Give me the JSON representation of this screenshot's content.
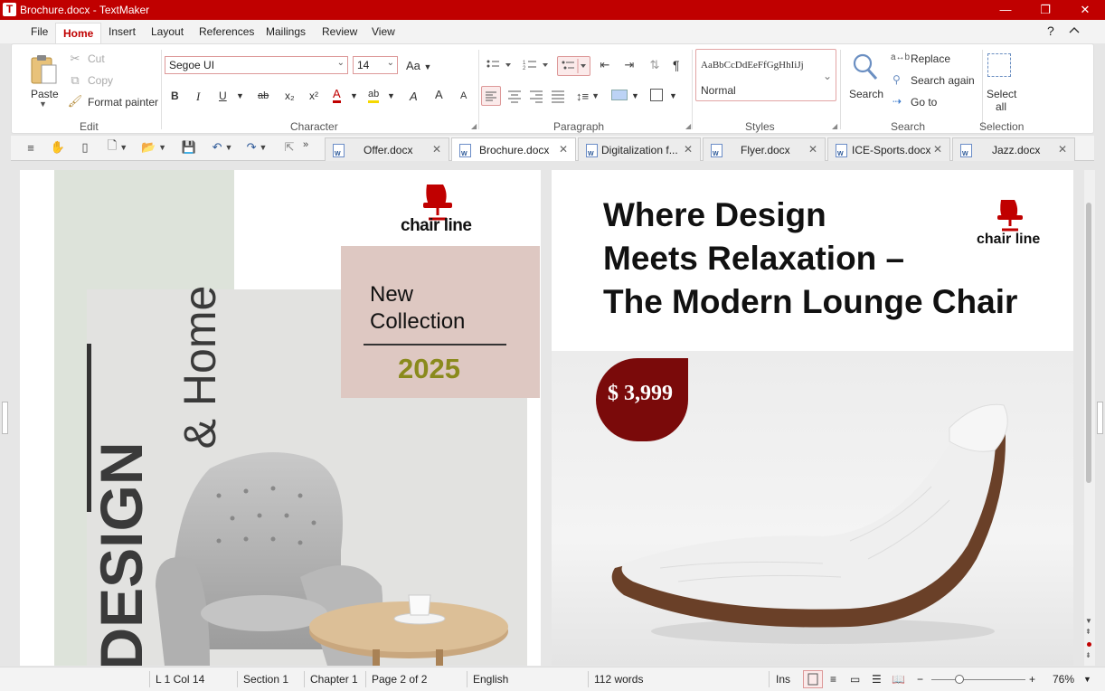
{
  "window": {
    "title": "Brochure.docx - TextMaker",
    "app_icon_letter": "T",
    "controls": {
      "minimize": "—",
      "maximize": "❐",
      "close": "✕"
    }
  },
  "menu": {
    "tabs": [
      "File",
      "Home",
      "Insert",
      "Layout",
      "References",
      "Mailings",
      "Review",
      "View"
    ],
    "active": "Home",
    "help": "?",
    "collapse": "^"
  },
  "ribbon": {
    "edit": {
      "label": "Edit",
      "paste": "Paste",
      "cut": "Cut",
      "copy": "Copy",
      "format_painter": "Format painter"
    },
    "character": {
      "label": "Character",
      "font_name": "Segoe UI",
      "font_size": "14",
      "font_case_icon": "Aa",
      "bold": "B",
      "italic": "I",
      "underline": "U",
      "strike": "ab",
      "subscript": "x₂",
      "superscript": "x²",
      "font_color": "A",
      "highlight": "ab",
      "clear": "A",
      "grow": "A",
      "shrink": "A"
    },
    "paragraph": {
      "label": "Paragraph",
      "pilcrow": "¶"
    },
    "styles": {
      "label": "Styles",
      "preview": "AaBbCcDdEeFfGgHhIiJj",
      "current": "Normal"
    },
    "search": {
      "label": "Search",
      "search": "Search",
      "replace": "Replace",
      "search_again": "Search again",
      "goto": "Go to"
    },
    "selection": {
      "label": "Selection",
      "select_all_line1": "Select",
      "select_all_line2": "all"
    }
  },
  "doc_tabs": [
    {
      "name": "Offer.docx",
      "active": false
    },
    {
      "name": "Brochure.docx",
      "active": true
    },
    {
      "name": "Digitalization f...",
      "active": false
    },
    {
      "name": "Flyer.docx",
      "active": false
    },
    {
      "name": "ICE-Sports.docx",
      "active": false
    },
    {
      "name": "Jazz.docx",
      "active": false
    }
  ],
  "left_page": {
    "logo_text": "chair line",
    "vertical_title_1": "DESIGN",
    "vertical_title_2": "& Home",
    "collection_line1": "New",
    "collection_line2": "Collection",
    "collection_year": "2025"
  },
  "right_page": {
    "headline_1": "Where Design",
    "headline_2": "Meets Relaxation –",
    "headline_3": "The Modern Lounge Chair",
    "logo_text": "chair line",
    "price": "$ 3,999"
  },
  "status": {
    "position": "L 1 Col 14",
    "section": "Section 1",
    "chapter": "Chapter 1",
    "page": "Page 2 of 2",
    "language": "English",
    "words": "112 words",
    "mode": "Ins",
    "zoom": "76%",
    "zoom_minus": "−",
    "zoom_plus": "+"
  },
  "colors": {
    "brand_red": "#c00000",
    "price_bg": "#7a0a0a",
    "year_olive": "#8a8a1c",
    "collection_bg": "#dec8c2",
    "sage_bg": "#dde3da"
  }
}
